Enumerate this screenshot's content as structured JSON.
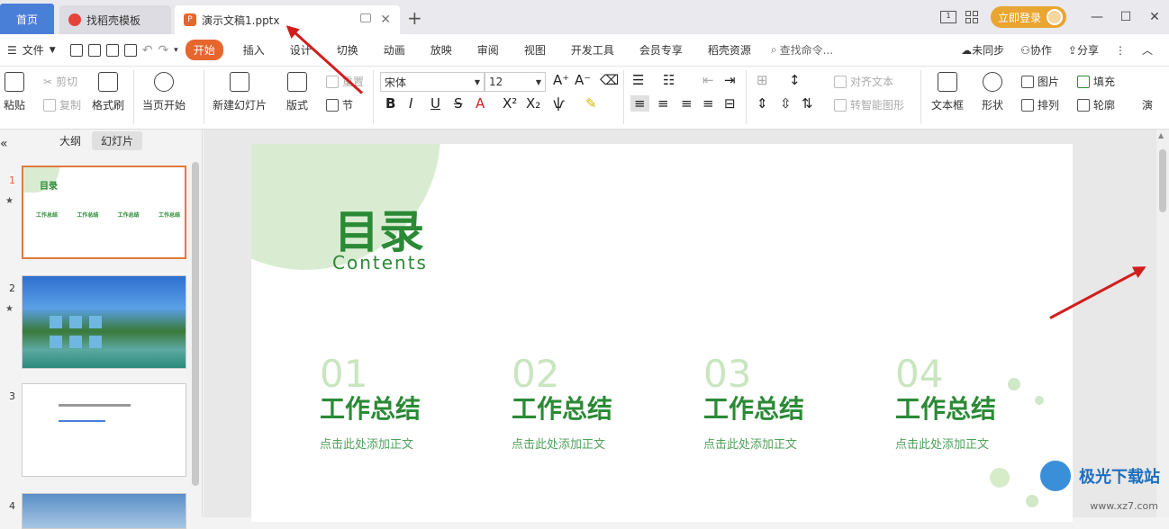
{
  "tabs": {
    "home": "首页",
    "template": "找稻壳模板",
    "doc": "演示文稿1.pptx"
  },
  "titlebar": {
    "login": "立即登录"
  },
  "menu": {
    "file": "文件",
    "items": [
      "插入",
      "设计",
      "切换",
      "动画",
      "放映",
      "审阅",
      "视图",
      "开发工具",
      "会员专享",
      "稻壳资源"
    ],
    "active": "开始",
    "search": "查找命令...",
    "unsync": "未同步",
    "collab": "协作",
    "share": "分享"
  },
  "ribbon": {
    "paste": "粘贴",
    "cut": "剪切",
    "copy": "复制",
    "format_painter": "格式刷",
    "from_current": "当页开始",
    "new_slide": "新建幻灯片",
    "layout": "版式",
    "reset": "重置",
    "section": "节",
    "font": "宋体",
    "size": "12",
    "align_text": "对齐文本",
    "smart_art": "转智能图形",
    "textbox": "文本框",
    "shape": "形状",
    "picture": "图片",
    "arrange": "排列",
    "fill": "填充",
    "outline": "轮廓",
    "more": "演"
  },
  "left_pane": {
    "outline": "大纲",
    "slides": "幻灯片",
    "numbers": [
      "1",
      "2",
      "3",
      "4"
    ]
  },
  "slide": {
    "title": "目录",
    "subtitle": "Contents",
    "items": [
      {
        "num": "01",
        "head": "工作总结",
        "text": "点击此处添加正文"
      },
      {
        "num": "02",
        "head": "工作总结",
        "text": "点击此处添加正文"
      },
      {
        "num": "03",
        "head": "工作总结",
        "text": "点击此处添加正文"
      },
      {
        "num": "04",
        "head": "工作总结",
        "text": "点击此处添加正文"
      }
    ]
  },
  "watermark": {
    "name": "极光下载站",
    "url": "www.xz7.com"
  },
  "colors": {
    "accent": "#e6662d",
    "green": "#2b8a35",
    "arrow": "#d21d1d"
  }
}
